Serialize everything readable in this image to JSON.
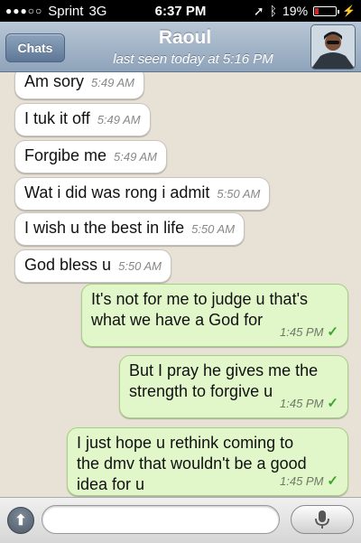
{
  "status_bar": {
    "carrier": "Sprint",
    "network": "3G",
    "time": "6:37 PM",
    "battery": "19%",
    "battery_level": 0.19
  },
  "nav": {
    "back_label": "Chats",
    "contact_name": "Raoul",
    "last_seen": "last seen today at 5:16 PM"
  },
  "messages": [
    {
      "dir": "in",
      "text": "Am sory",
      "time": "5:49 AM"
    },
    {
      "dir": "in",
      "text": "I tuk it off",
      "time": "5:49 AM"
    },
    {
      "dir": "in",
      "text": "Forgibe me",
      "time": "5:49 AM"
    },
    {
      "dir": "in",
      "text": "Wat i did was rong i admit",
      "time": "5:50 AM"
    },
    {
      "dir": "in",
      "text": "I wish u the best in life",
      "time": "5:50 AM"
    },
    {
      "dir": "in",
      "text": "God bless u",
      "time": "5:50 AM"
    },
    {
      "dir": "out",
      "lines": [
        "It's not for me to judge u that's",
        "what we have a God for"
      ],
      "time": "1:45 PM"
    },
    {
      "dir": "out",
      "lines": [
        "But I pray he gives me the",
        "strength to forgive u"
      ],
      "time": "1:45 PM"
    },
    {
      "dir": "out",
      "lines": [
        "I just hope u rethink coming to",
        "the dmv that wouldn't be a good",
        "idea for u"
      ],
      "time": "1:45 PM"
    }
  ],
  "composer": {
    "input_value": "",
    "placeholder": ""
  }
}
